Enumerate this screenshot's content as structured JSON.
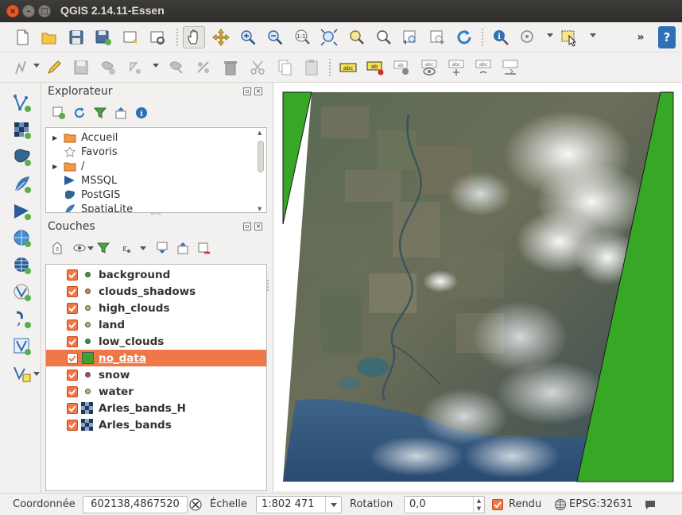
{
  "window": {
    "title": "QGIS 2.14.11-Essen",
    "close": "×",
    "minimize": "–",
    "maximize": "□"
  },
  "toolbar1": {
    "icons": [
      "new-project-icon",
      "open-project-icon",
      "save-project-icon",
      "save-as-icon",
      "new-print-composer-icon",
      "composer-manager-icon",
      "pan-icon",
      "pan-to-selection-icon",
      "zoom-in-icon",
      "zoom-out-icon",
      "zoom-native-icon",
      "zoom-full-icon",
      "zoom-to-layer-icon",
      "zoom-to-selection-icon",
      "zoom-last-icon",
      "zoom-next-icon",
      "refresh-icon",
      "identify-icon",
      "measure-icon",
      "select-features-icon"
    ],
    "overflow": "»",
    "help": "?"
  },
  "toolbar2": {
    "icons": [
      "edit-digitize-icon",
      "toggle-editing-icon",
      "save-edits-icon",
      "add-feature-icon",
      "move-feature-icon",
      "node-tool-icon",
      "delete-selected-icon",
      "cut-features-icon",
      "copy-features-icon",
      "paste-features-icon",
      "label-abc-icon",
      "layer-labeling-icon",
      "pin-labels-icon",
      "show-hide-labels-icon",
      "move-label-icon",
      "rotate-label-icon",
      "change-label-icon"
    ],
    "labels": {
      "abc": "abc",
      "ab": "ab",
      "ab2": "ab",
      "ab3": "abc",
      "ab4": "abc",
      "ab5": "abc"
    }
  },
  "lefttb": {
    "icons": [
      "add-vector-layer-icon",
      "add-raster-layer-icon",
      "add-postgis-layer-icon",
      "add-spatialite-layer-icon",
      "add-mssql-layer-icon",
      "add-wms-layer-icon",
      "add-wcs-layer-icon",
      "add-wfs-layer-icon",
      "add-delimited-text-icon",
      "add-virtual-layer-icon",
      "new-shapefile-icon"
    ]
  },
  "explorer": {
    "title": "Explorateur",
    "items": [
      {
        "label": "Accueil",
        "icon": "folder-icon",
        "expandable": true
      },
      {
        "label": "Favoris",
        "icon": "star-icon",
        "expandable": false
      },
      {
        "label": "/",
        "icon": "folder-icon",
        "expandable": true
      },
      {
        "label": "MSSQL",
        "icon": "mssql-icon",
        "expandable": false
      },
      {
        "label": "PostGIS",
        "icon": "postgis-icon",
        "expandable": false
      },
      {
        "label": "SpatiaLite",
        "icon": "spatialite-icon",
        "expandable": false
      }
    ]
  },
  "layers": {
    "title": "Couches",
    "items": [
      {
        "label": "background",
        "type": "point",
        "color": "#2e9e34",
        "selected": false
      },
      {
        "label": "clouds_shadows",
        "type": "point",
        "color": "#c48a5a",
        "selected": false
      },
      {
        "label": "high_clouds",
        "type": "point",
        "color": "#c9b169",
        "selected": false
      },
      {
        "label": "land",
        "type": "point",
        "color": "#b8b16a",
        "selected": false
      },
      {
        "label": "low_clouds",
        "type": "point",
        "color": "#1c9a2a",
        "selected": false
      },
      {
        "label": "no_data",
        "type": "polygon",
        "color": "#3aa52a",
        "selected": true
      },
      {
        "label": "snow",
        "type": "point",
        "color": "#c23b4a",
        "selected": false
      },
      {
        "label": "water",
        "type": "point",
        "color": "#c9b46a",
        "selected": false
      },
      {
        "label": "Arles_bands_H",
        "type": "raster",
        "color": "#1d3a5c",
        "selected": false
      },
      {
        "label": "Arles_bands",
        "type": "raster",
        "color": "#1d3a5c",
        "selected": false
      }
    ]
  },
  "map": {
    "polygon_color": "#37a826",
    "background": "#ffffff"
  },
  "statusbar": {
    "coord_label": "Coordonnée",
    "coord_value": "602138,4867520",
    "scale_label": "Échelle",
    "scale_value": "1:802 471",
    "rotation_label": "Rotation",
    "rotation_value": "0,0",
    "render_label": "Rendu",
    "crs": "EPSG:32631"
  }
}
